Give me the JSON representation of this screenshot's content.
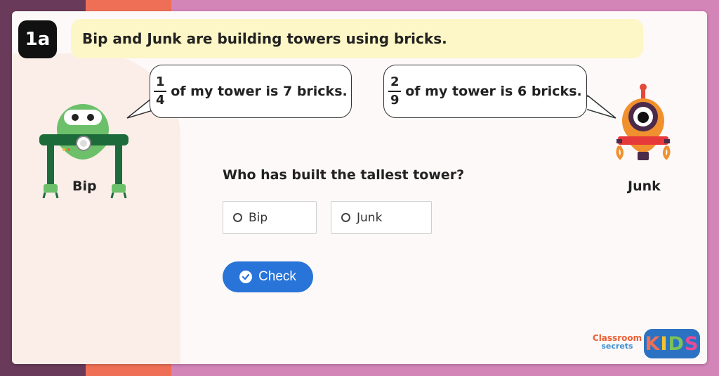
{
  "question": {
    "badge": "1a",
    "title": "Bip and Junk are building towers using bricks.",
    "prompt": "Who has built the tallest tower?"
  },
  "bubbles": {
    "bip": {
      "numerator": "1",
      "denominator": "4",
      "text": "of my tower is 7 bricks."
    },
    "junk": {
      "numerator": "2",
      "denominator": "9",
      "text": "of my tower is 6 bricks."
    }
  },
  "characters": {
    "bip": {
      "name": "Bip",
      "color": "#6cc06a"
    },
    "junk": {
      "name": "Junk",
      "color": "#f0902e"
    }
  },
  "options": [
    {
      "label": "Bip"
    },
    {
      "label": "Junk"
    }
  ],
  "check_button": {
    "label": "Check"
  },
  "logo": {
    "line1": "Classroom",
    "line2": "secrets",
    "kids": [
      "K",
      "I",
      "D",
      "S"
    ]
  },
  "colors": {
    "accent": "#2874d8",
    "title_bg": "#fdf6c6",
    "bg_orange": "#ef6f56",
    "bg_pink": "#d385b8"
  }
}
